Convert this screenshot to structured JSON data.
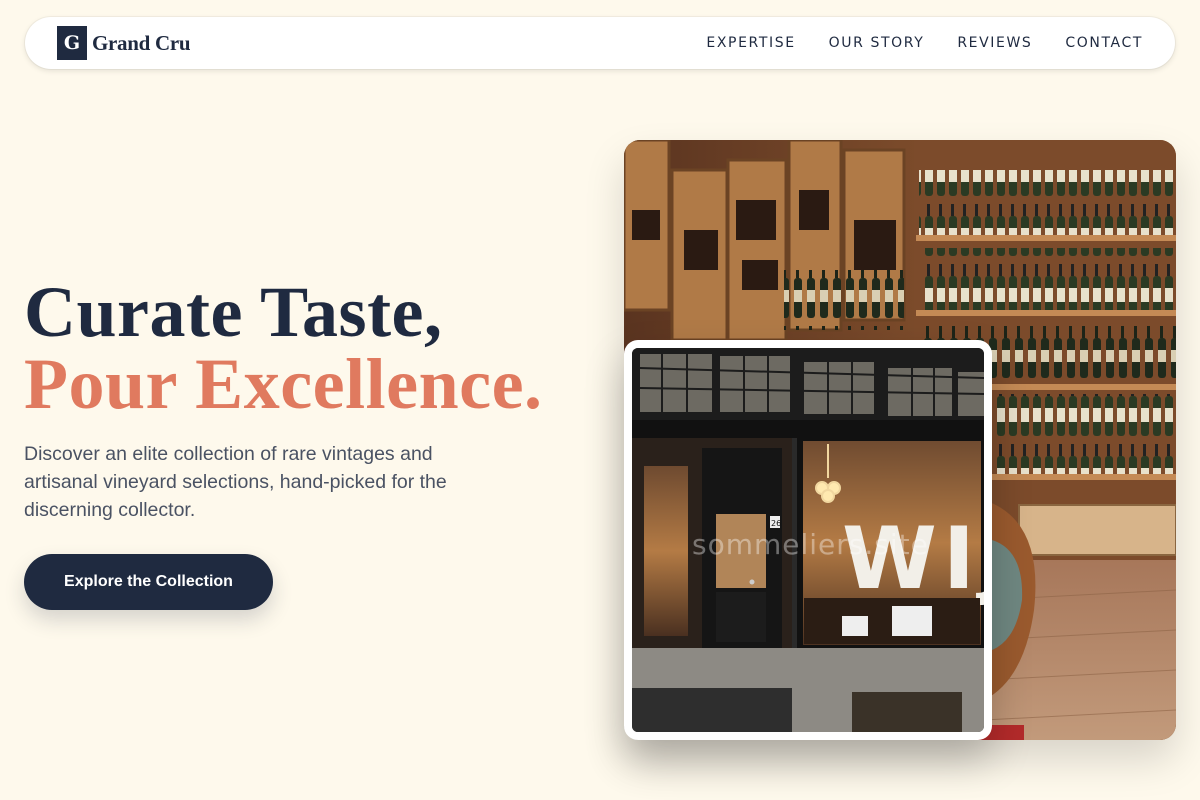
{
  "brand": {
    "mark": "G",
    "name": "Grand Cru"
  },
  "nav": {
    "items": [
      {
        "label": "EXPERTISE"
      },
      {
        "label": "OUR STORY"
      },
      {
        "label": "REVIEWS"
      },
      {
        "label": "CONTACT"
      }
    ]
  },
  "hero": {
    "title_line1": "Curate Taste,",
    "title_line2": "Pour Excellence.",
    "description": "Discover an elite collection of rare vintages and artisanal vineyard selections, hand-picked for the discerning collector.",
    "cta_label": "Explore the Collection"
  },
  "images": {
    "wine_shelves": {
      "alt": "Wine shop interior with wooden shelves full of bottles"
    },
    "storefront": {
      "alt": "Wine shop storefront"
    },
    "storefront_sign": "WIJN",
    "storefront_house_number": "26",
    "watermark": "sommeliers.site"
  },
  "colors": {
    "background": "#fef9ec",
    "navy": "#1f2a40",
    "accent": "#e07a5f",
    "body_text": "#4a5263"
  }
}
